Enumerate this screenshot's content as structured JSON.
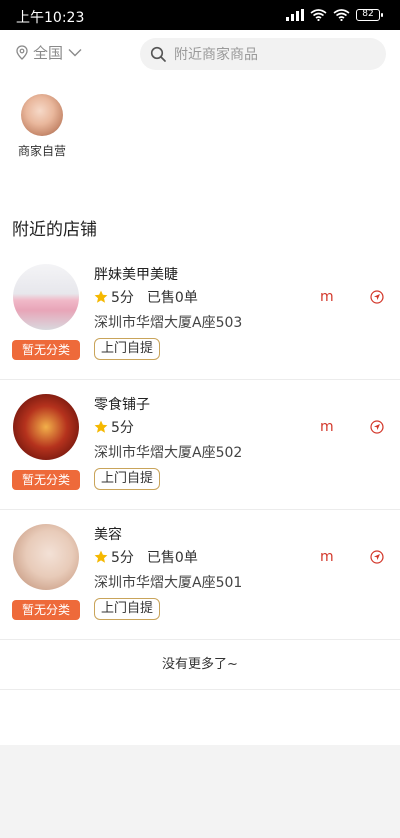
{
  "status_bar": {
    "time": "上午10:23",
    "battery": "82"
  },
  "header": {
    "region": "全国",
    "search_placeholder": "附近商家商品"
  },
  "categories": [
    {
      "label": "商家自营"
    }
  ],
  "section_title": "附近的店铺",
  "stores": [
    {
      "name": "胖妹美甲美睫",
      "rating": "5分",
      "sold": "已售0单",
      "address": "深圳市华熠大厦A座503",
      "category_tag": "暂无分类",
      "delivery_tag": "上门自提",
      "distance": "m"
    },
    {
      "name": "零食铺子",
      "rating": "5分",
      "sold": "已售0单",
      "address": "深圳市华熠大厦A座502",
      "category_tag": "暂无分类",
      "delivery_tag": "上门自提",
      "distance": "m"
    },
    {
      "name": "美容",
      "rating": "5分",
      "sold": "已售0单",
      "address": "深圳市华熠大厦A座501",
      "category_tag": "暂无分类",
      "delivery_tag": "上门自提",
      "distance": "m"
    }
  ],
  "footer_text": "没有更多了~",
  "colors": {
    "accent_orange": "#ee6a3a",
    "distance_red": "#d3372a",
    "star_yellow": "#f5b800",
    "pickup_border": "#c9a45a"
  }
}
